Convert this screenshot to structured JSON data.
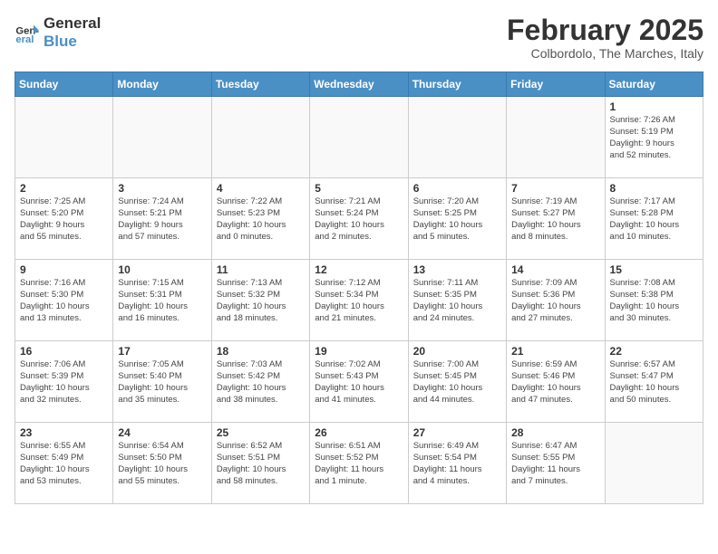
{
  "logo": {
    "line1": "General",
    "line2": "Blue"
  },
  "title": "February 2025",
  "subtitle": "Colbordolo, The Marches, Italy",
  "weekdays": [
    "Sunday",
    "Monday",
    "Tuesday",
    "Wednesday",
    "Thursday",
    "Friday",
    "Saturday"
  ],
  "weeks": [
    [
      {
        "day": "",
        "info": ""
      },
      {
        "day": "",
        "info": ""
      },
      {
        "day": "",
        "info": ""
      },
      {
        "day": "",
        "info": ""
      },
      {
        "day": "",
        "info": ""
      },
      {
        "day": "",
        "info": ""
      },
      {
        "day": "1",
        "info": "Sunrise: 7:26 AM\nSunset: 5:19 PM\nDaylight: 9 hours\nand 52 minutes."
      }
    ],
    [
      {
        "day": "2",
        "info": "Sunrise: 7:25 AM\nSunset: 5:20 PM\nDaylight: 9 hours\nand 55 minutes."
      },
      {
        "day": "3",
        "info": "Sunrise: 7:24 AM\nSunset: 5:21 PM\nDaylight: 9 hours\nand 57 minutes."
      },
      {
        "day": "4",
        "info": "Sunrise: 7:22 AM\nSunset: 5:23 PM\nDaylight: 10 hours\nand 0 minutes."
      },
      {
        "day": "5",
        "info": "Sunrise: 7:21 AM\nSunset: 5:24 PM\nDaylight: 10 hours\nand 2 minutes."
      },
      {
        "day": "6",
        "info": "Sunrise: 7:20 AM\nSunset: 5:25 PM\nDaylight: 10 hours\nand 5 minutes."
      },
      {
        "day": "7",
        "info": "Sunrise: 7:19 AM\nSunset: 5:27 PM\nDaylight: 10 hours\nand 8 minutes."
      },
      {
        "day": "8",
        "info": "Sunrise: 7:17 AM\nSunset: 5:28 PM\nDaylight: 10 hours\nand 10 minutes."
      }
    ],
    [
      {
        "day": "9",
        "info": "Sunrise: 7:16 AM\nSunset: 5:30 PM\nDaylight: 10 hours\nand 13 minutes."
      },
      {
        "day": "10",
        "info": "Sunrise: 7:15 AM\nSunset: 5:31 PM\nDaylight: 10 hours\nand 16 minutes."
      },
      {
        "day": "11",
        "info": "Sunrise: 7:13 AM\nSunset: 5:32 PM\nDaylight: 10 hours\nand 18 minutes."
      },
      {
        "day": "12",
        "info": "Sunrise: 7:12 AM\nSunset: 5:34 PM\nDaylight: 10 hours\nand 21 minutes."
      },
      {
        "day": "13",
        "info": "Sunrise: 7:11 AM\nSunset: 5:35 PM\nDaylight: 10 hours\nand 24 minutes."
      },
      {
        "day": "14",
        "info": "Sunrise: 7:09 AM\nSunset: 5:36 PM\nDaylight: 10 hours\nand 27 minutes."
      },
      {
        "day": "15",
        "info": "Sunrise: 7:08 AM\nSunset: 5:38 PM\nDaylight: 10 hours\nand 30 minutes."
      }
    ],
    [
      {
        "day": "16",
        "info": "Sunrise: 7:06 AM\nSunset: 5:39 PM\nDaylight: 10 hours\nand 32 minutes."
      },
      {
        "day": "17",
        "info": "Sunrise: 7:05 AM\nSunset: 5:40 PM\nDaylight: 10 hours\nand 35 minutes."
      },
      {
        "day": "18",
        "info": "Sunrise: 7:03 AM\nSunset: 5:42 PM\nDaylight: 10 hours\nand 38 minutes."
      },
      {
        "day": "19",
        "info": "Sunrise: 7:02 AM\nSunset: 5:43 PM\nDaylight: 10 hours\nand 41 minutes."
      },
      {
        "day": "20",
        "info": "Sunrise: 7:00 AM\nSunset: 5:45 PM\nDaylight: 10 hours\nand 44 minutes."
      },
      {
        "day": "21",
        "info": "Sunrise: 6:59 AM\nSunset: 5:46 PM\nDaylight: 10 hours\nand 47 minutes."
      },
      {
        "day": "22",
        "info": "Sunrise: 6:57 AM\nSunset: 5:47 PM\nDaylight: 10 hours\nand 50 minutes."
      }
    ],
    [
      {
        "day": "23",
        "info": "Sunrise: 6:55 AM\nSunset: 5:49 PM\nDaylight: 10 hours\nand 53 minutes."
      },
      {
        "day": "24",
        "info": "Sunrise: 6:54 AM\nSunset: 5:50 PM\nDaylight: 10 hours\nand 55 minutes."
      },
      {
        "day": "25",
        "info": "Sunrise: 6:52 AM\nSunset: 5:51 PM\nDaylight: 10 hours\nand 58 minutes."
      },
      {
        "day": "26",
        "info": "Sunrise: 6:51 AM\nSunset: 5:52 PM\nDaylight: 11 hours\nand 1 minute."
      },
      {
        "day": "27",
        "info": "Sunrise: 6:49 AM\nSunset: 5:54 PM\nDaylight: 11 hours\nand 4 minutes."
      },
      {
        "day": "28",
        "info": "Sunrise: 6:47 AM\nSunset: 5:55 PM\nDaylight: 11 hours\nand 7 minutes."
      },
      {
        "day": "",
        "info": ""
      }
    ]
  ]
}
